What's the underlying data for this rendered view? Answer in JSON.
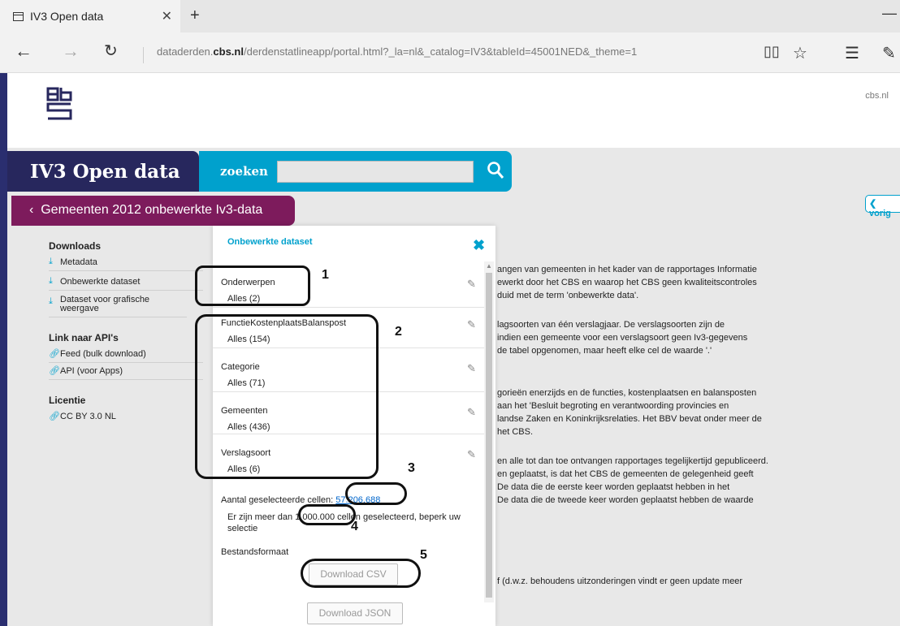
{
  "browser": {
    "tab_title": "IV3 Open data",
    "url_prefix": "dataderden.",
    "url_domain": "cbs.nl",
    "url_rest": "/derdenstatlineapp/portal.html?_la=nl&_catalog=IV3&tableId=45001NED&_theme=1"
  },
  "header": {
    "cbs_link": "cbs.nl",
    "brand": "IV3 Open data",
    "search_label": "zoeken",
    "breadcrumb": "Gemeenten 2012 onbewerkte Iv3-data",
    "prev_label": "vorig"
  },
  "leftmenu": {
    "downloads_heading": "Downloads",
    "downloads": [
      "Metadata",
      "Onbewerkte dataset",
      "Dataset voor grafische weergave"
    ],
    "api_heading": "Link naar API's",
    "api": [
      "Feed (bulk download)",
      "API (voor Apps)"
    ],
    "license_heading": "Licentie",
    "license": [
      "CC BY 3.0 NL"
    ]
  },
  "background_text": [
    "angen van gemeenten in het kader van de rapportages Informatie",
    "ewerkt door het CBS en waarop het CBS geen kwaliteitscontroles",
    "duid met de term 'onbewerkte data'.",
    "lagsoorten van één verslagjaar. De verslagsoorten zijn de",
    "indien een gemeente voor een verslagsoort geen Iv3-gegevens",
    "de tabel opgenomen, maar heeft elke cel de waarde '.'",
    "gorieën enerzijds en de functies, kostenplaatsen en balansposten",
    "aan het 'Besluit begroting en verantwoording provincies en",
    "landse Zaken en Koninkrijksrelaties. Het BBV bevat onder meer de",
    " het CBS.",
    "en alle tot dan toe ontvangen rapportages tegelijkertijd gepubliceerd.",
    "en geplaatst, is dat het CBS de gemeenten de gelegenheid geeft",
    "De data die de eerste keer worden geplaatst hebben in het",
    "De data die de tweede keer worden geplaatst hebben de waarde",
    "f (d.w.z. behoudens uitzonderingen vindt er geen update meer"
  ],
  "modal": {
    "title": "Onbewerkte dataset",
    "filters": [
      {
        "label": "Onderwerpen",
        "value": "Alles (2)"
      },
      {
        "label": "FunctieKostenplaatsBalanspost",
        "value": "Alles (154)"
      },
      {
        "label": "Categorie",
        "value": "Alles (71)"
      },
      {
        "label": "Gemeenten",
        "value": "Alles (436)"
      },
      {
        "label": "Verslagsoort",
        "value": "Alles (6)"
      }
    ],
    "cells_label": "Aantal geselecteerde cellen:",
    "cells_value": "57.206.688",
    "warning_a": "Er zijn meer dan ",
    "warning_num": "1.000.000",
    "warning_b": " cellen geselecteerd, beperk uw selectie",
    "format_label": "Bestandsformaat",
    "btn_csv": "Download CSV",
    "btn_json": "Download JSON"
  },
  "annotations": [
    "1",
    "2",
    "3",
    "4",
    "5"
  ]
}
